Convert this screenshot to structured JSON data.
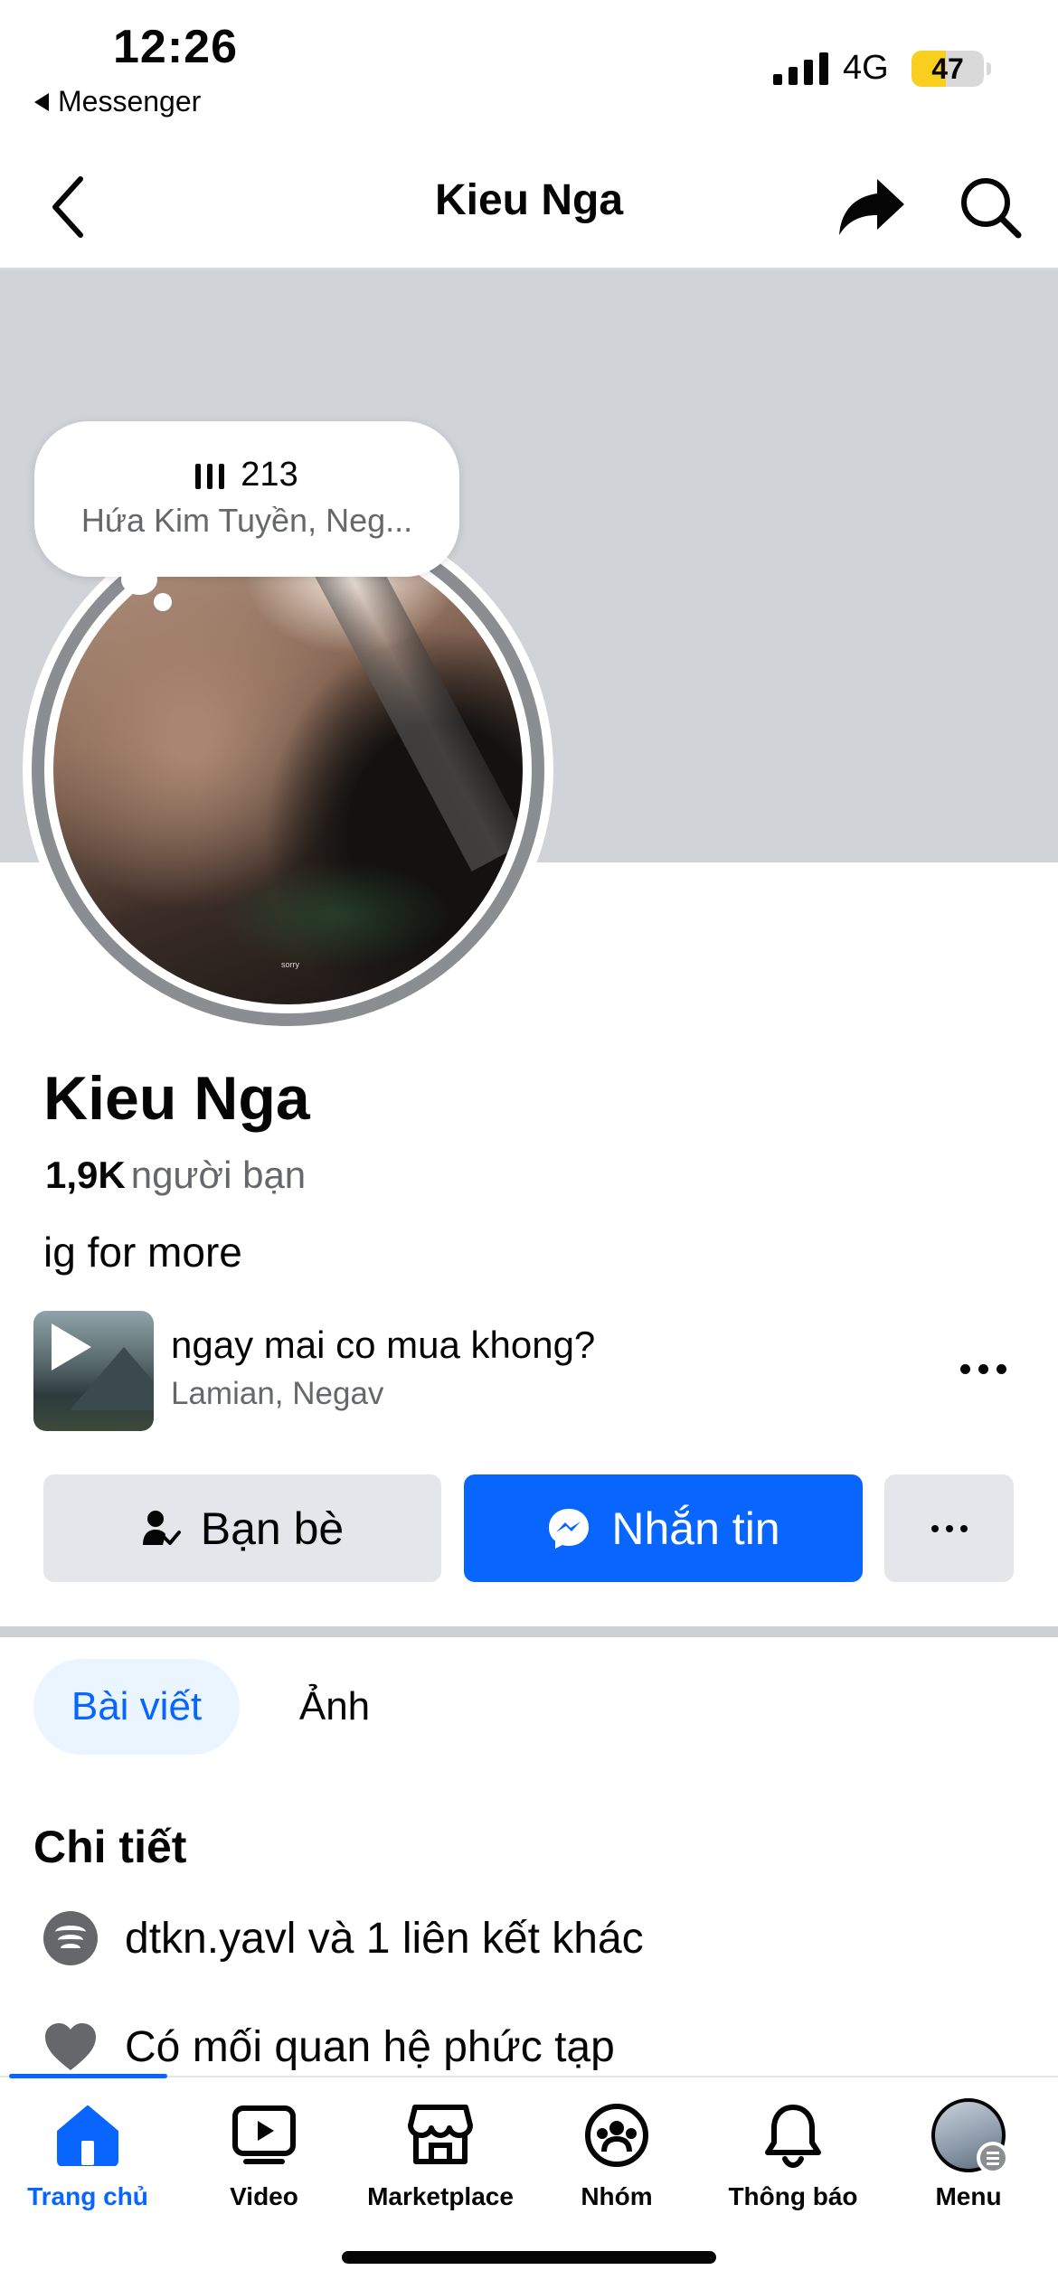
{
  "status_bar": {
    "time": "12:26",
    "back_app": "Messenger",
    "network": "4G",
    "battery": "47",
    "battery_level": 0.47
  },
  "header": {
    "title": "Kieu Nga",
    "icons": [
      "chevron-left-icon",
      "share-icon",
      "search-icon"
    ]
  },
  "profile": {
    "name": "Kieu Nga",
    "friend_count": "1,9K",
    "friend_label": "người bạn",
    "bio": "ig for more",
    "avatar_caption": "sorry"
  },
  "note": {
    "count": "213",
    "artist": "Hứa Kim Tuyền, Neg..."
  },
  "music": {
    "title": "ngay mai co mua khong?",
    "artist": "Lamian, Negav"
  },
  "actions": {
    "friends_label": "Bạn bè",
    "message_label": "Nhắn tin"
  },
  "tabs": [
    {
      "label": "Bài viết",
      "active": true
    },
    {
      "label": "Ảnh",
      "active": false
    }
  ],
  "details": {
    "title": "Chi tiết",
    "links": "dtkn.yavl và 1 liên kết khác",
    "relationship": "Có mối quan hệ phức tạp"
  },
  "bottom_nav": [
    {
      "label": "Trang chủ",
      "icon": "home-icon",
      "active": true
    },
    {
      "label": "Video",
      "icon": "video-icon",
      "active": false
    },
    {
      "label": "Marketplace",
      "icon": "marketplace-icon",
      "active": false
    },
    {
      "label": "Nhóm",
      "icon": "groups-icon",
      "active": false
    },
    {
      "label": "Thông báo",
      "icon": "bell-icon",
      "active": false
    },
    {
      "label": "Menu",
      "icon": "profile-avatar",
      "active": false
    }
  ],
  "colors": {
    "accent": "#0866ff",
    "secondary_text": "#65676b",
    "button_gray": "#e4e6eb",
    "cover": "#d0d3d8",
    "battery_fill": "#f8cf1e"
  }
}
